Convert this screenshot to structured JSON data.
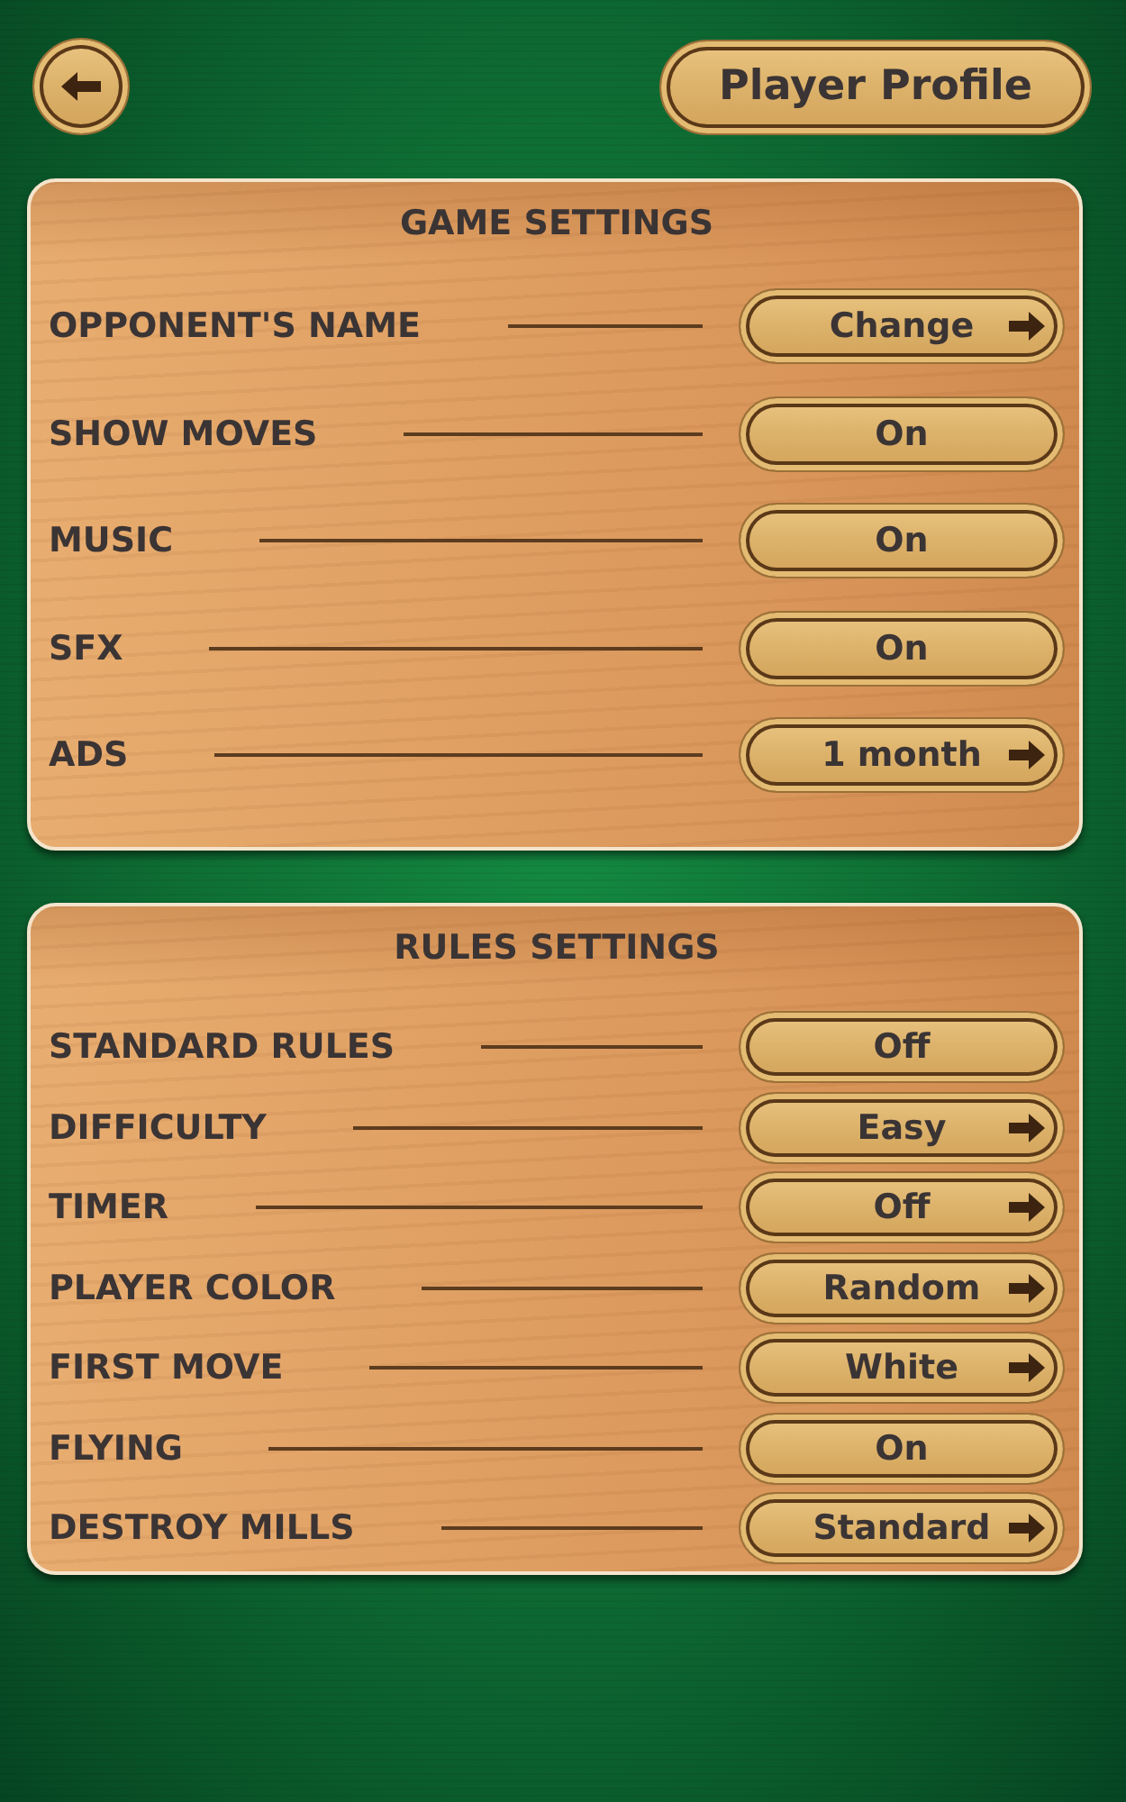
{
  "header": {
    "profile_button": "Player Profile"
  },
  "sections": [
    {
      "title": "GAME SETTINGS",
      "rows": [
        {
          "label": "OPPONENT'S NAME",
          "value": "Change",
          "kind": "choice"
        },
        {
          "label": "SHOW MOVES",
          "value": "On",
          "kind": "toggle"
        },
        {
          "label": "MUSIC",
          "value": "On",
          "kind": "toggle"
        },
        {
          "label": "SFX",
          "value": "On",
          "kind": "toggle"
        },
        {
          "label": "ADS",
          "value": "1 month",
          "kind": "choice"
        }
      ]
    },
    {
      "title": "RULES SETTINGS",
      "rows": [
        {
          "label": "STANDARD RULES",
          "value": "Off",
          "kind": "toggle"
        },
        {
          "label": "DIFFICULTY",
          "value": "Easy",
          "kind": "choice"
        },
        {
          "label": "TIMER",
          "value": "Off",
          "kind": "choice"
        },
        {
          "label": "PLAYER COLOR",
          "value": "Random",
          "kind": "choice"
        },
        {
          "label": "FIRST MOVE",
          "value": "White",
          "kind": "choice"
        },
        {
          "label": "FLYING",
          "value": "On",
          "kind": "toggle"
        },
        {
          "label": "DESTROY MILLS",
          "value": "Standard",
          "kind": "choice"
        }
      ]
    }
  ]
}
